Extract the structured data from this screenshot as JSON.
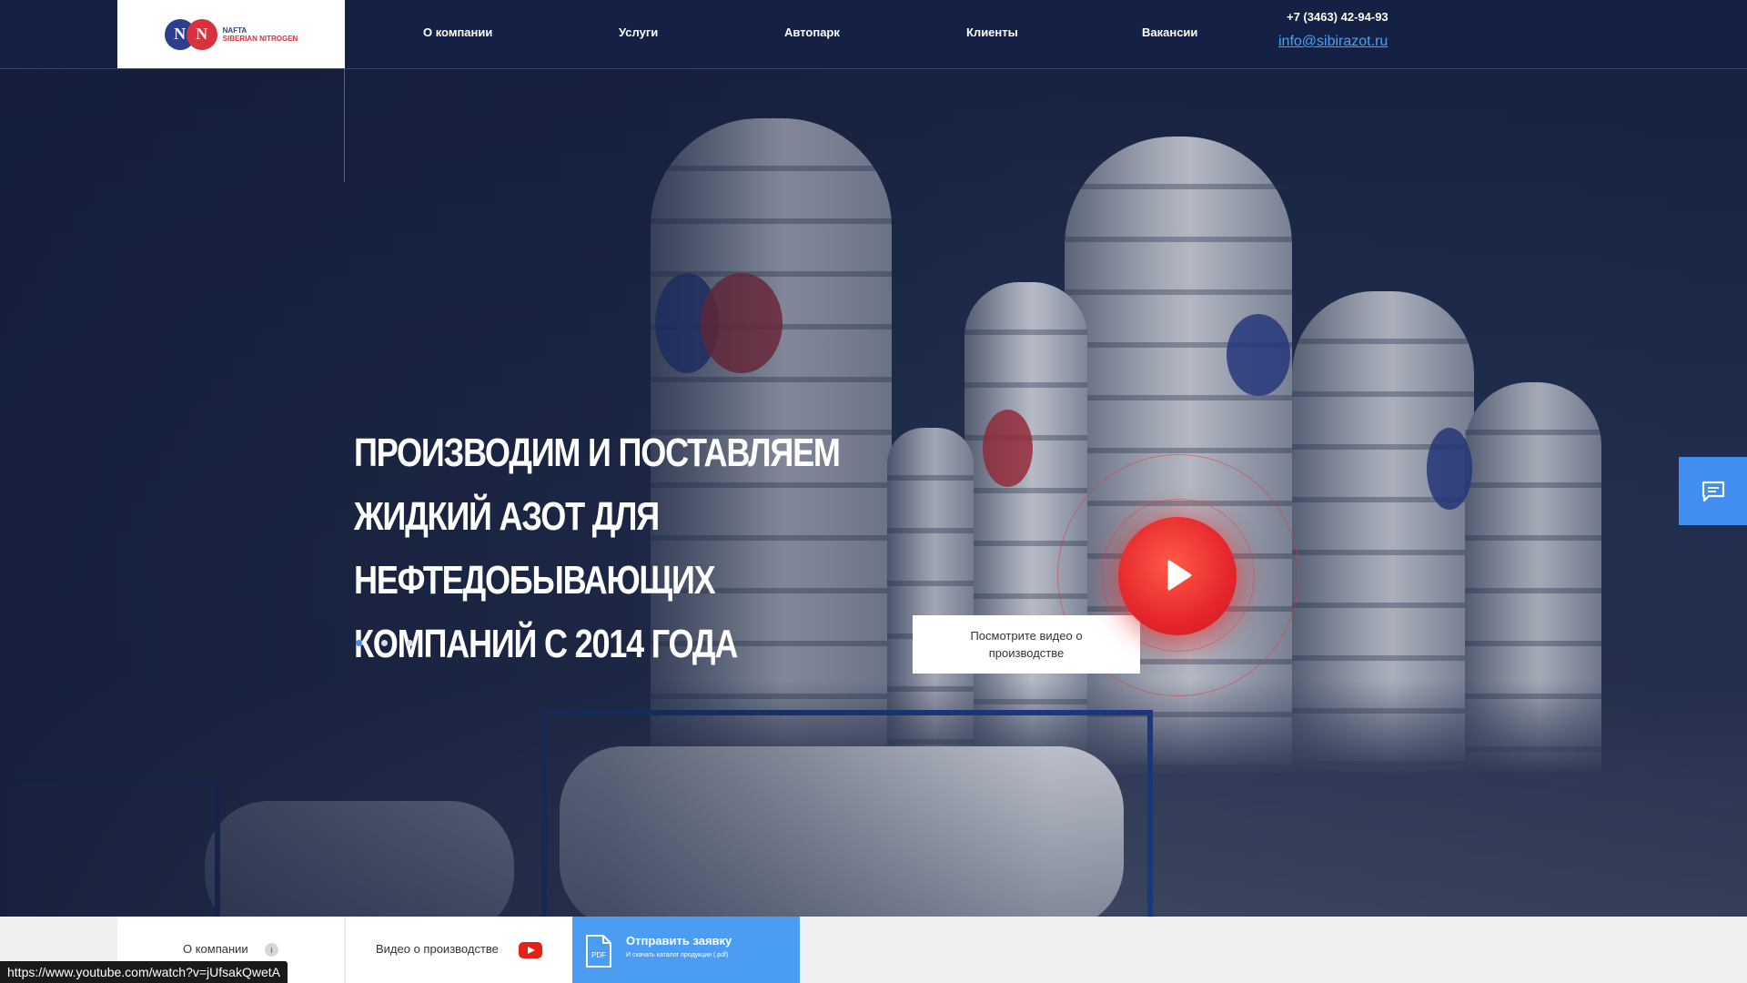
{
  "header": {
    "logo": {
      "mark_left": "N",
      "mark_right": "N",
      "line1": "NAFTA",
      "line2": "SIBERIAN NITROGEN"
    },
    "nav": [
      {
        "label": "О компании"
      },
      {
        "label": "Услуги"
      },
      {
        "label": "Автопарк"
      },
      {
        "label": "Клиенты"
      },
      {
        "label": "Вакансии"
      }
    ],
    "phone": "+7 (3463) 42-94-93",
    "email": "info@sibirazot.ru"
  },
  "hero": {
    "headline_lines": [
      "Производим и поставляем",
      "жидкий азот для нефтедобывающих",
      "компаний с 2014 года"
    ],
    "slider": {
      "count": 3,
      "active": 1
    },
    "video_label": "Посмотрите видео о производстве"
  },
  "bottom_bar": {
    "about_label": "О компании",
    "video_label": "Видео о производстве",
    "request_title": "Отправить заявку",
    "request_subtitle": "И скачать каталог продукции (.pdf)",
    "pdf_icon_text": "PDF"
  },
  "status_bar": {
    "url": "https://www.youtube.com/watch?v=jUfsakQwetA"
  },
  "colors": {
    "accent_blue": "#4a9df2",
    "play_red": "#e6262c",
    "header_bg": "#142145"
  },
  "icons": [
    "chat-icon",
    "play-icon",
    "info-icon",
    "youtube-icon",
    "pdf-icon"
  ]
}
